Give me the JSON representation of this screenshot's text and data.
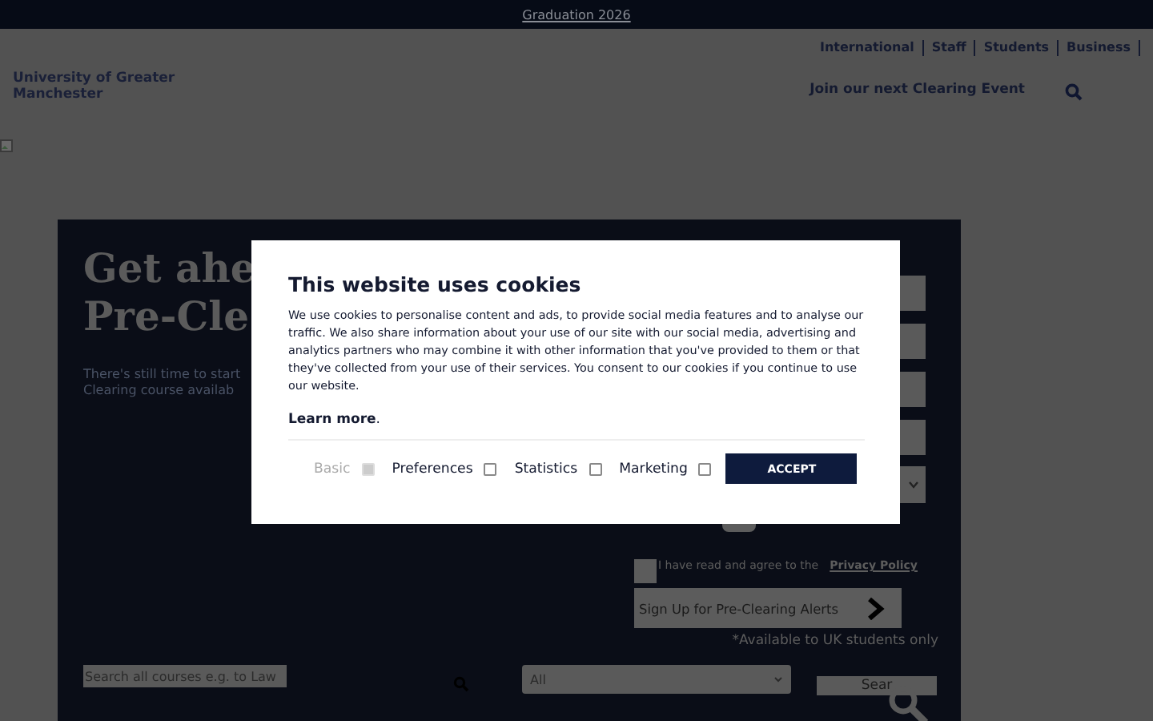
{
  "top_bar": {
    "link": "Graduation 2026"
  },
  "header": {
    "logo_alt": "University of Greater Manchester",
    "utility_links": [
      "International",
      "Staff",
      "Students",
      "Business"
    ],
    "event_link": "Join our next Clearing Event"
  },
  "hero": {
    "heading_lines": [
      "Get ahe",
      "Pre-Cle"
    ],
    "intro_lines": [
      "There's still time to start",
      "Clearing course availab"
    ],
    "consent": {
      "checked": false,
      "text": "I have read and agree to the",
      "link": "Privacy Policy"
    },
    "signup_button": "Sign Up for Pre-Clearing Alerts",
    "note": "*Available to UK students only"
  },
  "course_search": {
    "placeholder": "Search all courses e.g. to Law",
    "select": "All",
    "button": "Sear"
  },
  "cookie_dialog": {
    "title": "This website uses cookies",
    "body": "We use cookies to personalise content and ads, to provide social media features and to analyse our traffic. We also share information about your use of our site with our social media, advertising and analytics partners who may combine it with other information that you've provided to them or that they've collected from your use of their services. You consent to our cookies if you continue to use our website.",
    "learn_more": "**Learn more**.",
    "options": [
      {
        "label": "Basic",
        "checked": true,
        "disabled": true
      },
      {
        "label": "Preferences",
        "checked": false,
        "disabled": false
      },
      {
        "label": "Statistics",
        "checked": false,
        "disabled": false
      },
      {
        "label": "Marketing",
        "checked": false,
        "disabled": false
      }
    ],
    "accept": "ACCEPT"
  }
}
